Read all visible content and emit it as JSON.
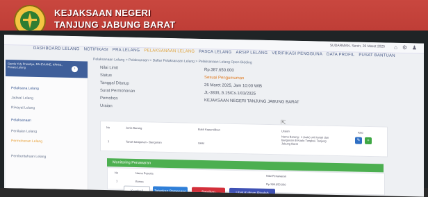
{
  "banner": {
    "org_line1": "KEJAKSAAN NEGERI",
    "org_line2": "TANJUNG JABUNG BARAT",
    "logo_icon": "emblem-icon",
    "color": "#c4433b"
  },
  "topbar": {
    "user_text": "SUDARMAN, Senin, 20 Maret 2025",
    "icons": [
      "home-icon",
      "settings-icon",
      "user-icon"
    ]
  },
  "nav": {
    "items": [
      "DASHBOARD LELANG",
      "NOTIFIKASI",
      "PRA LELANG",
      "PELAKSANAAN LELANG",
      "PASCA LELANG",
      "ARSIP LELANG",
      "VERIFIKASI PENGGUNA",
      "DATA PROFIL",
      "PUSAT BANTUAN"
    ],
    "active_index": 3,
    "active_color": "#e0a33a"
  },
  "sidebar": {
    "profile_name": "Ganda Yuly Prasetiya, PALEVIANE, KPKNL, Penata Lelang",
    "items": [
      "Pelaksana Lelang",
      "Jadwal Lelang",
      "Riwayat Lelang",
      "Pelaksanaan",
      "Penilaian Lelang",
      "Permohonan Lelang",
      "Pemberitahuan Lelang"
    ],
    "selected_index": 2
  },
  "breadcrumb": "Pelaksanaan Lelang  >  Pelaksanaan  >  Daftar Pelaksanaan Lelang  >  Pelaksanaan Lelang Open Bidding",
  "details": {
    "rows": [
      {
        "label": "Nilai Limit",
        "value": "Rp.387.650.000"
      },
      {
        "label": "Status",
        "value": "Sesuai Pengumuman"
      },
      {
        "label": "Tanggal Ditutup",
        "value": "26 Maret 2025, Jam 10:00 WIB"
      },
      {
        "label": "Surat Permohonan",
        "value": "JL-383/L.5.15/Cs.1/03/2025"
      },
      {
        "label": "Pemohon",
        "value": "KEJAKSAAN NEGERI TANJUNG JABUNG BARAT"
      },
      {
        "label": "Uraian",
        "value": ""
      }
    ],
    "status_color": "#e07a1f"
  },
  "file_table": {
    "headers": [
      "No",
      "Jenis Barang",
      "Bukti Kepemilikan",
      "Uraian",
      "Aksi"
    ],
    "row": {
      "no": "1",
      "jenis": "Tanah bangunan - Bangunan",
      "bukti": "SHM",
      "uraian": "Nama Barang : 1 (satu) unit tanah dan bangunan di Kuala Tungkal, Tanjung Jabung Barat"
    },
    "action_icons": [
      "view-icon",
      "add-icon"
    ]
  },
  "monitoring": {
    "title": "Monitoring Penawaran",
    "headers": [
      "No",
      "Nama Peserta",
      "Nilai Penawaran"
    ],
    "row": {
      "no": "1",
      "name": "Bunea",
      "value": "Rp.389.650.000"
    },
    "color": "#4caf50"
  },
  "buttons": {
    "back": "Kembali",
    "primary": "Tetapkan Pemenang",
    "cancel": "Batalkan",
    "view_result": "Lihat Kutipan Risalah"
  }
}
